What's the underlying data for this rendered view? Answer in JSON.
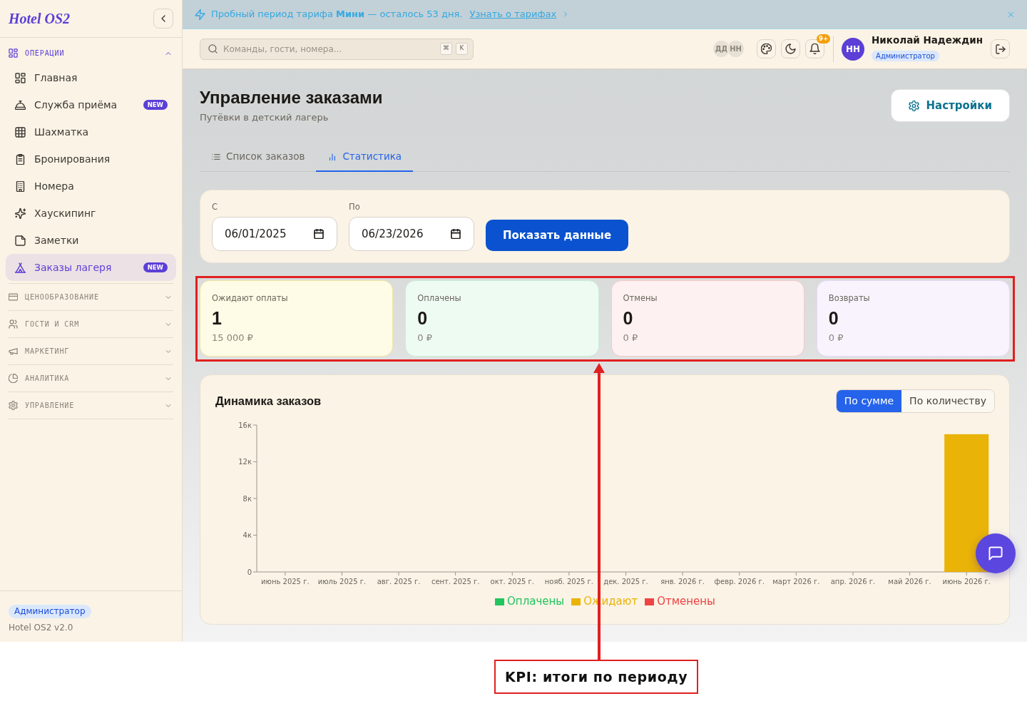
{
  "sidebar": {
    "logo": "Hotel OS2",
    "groups": [
      {
        "label": "ОПЕРАЦИИ",
        "expanded": true,
        "items": [
          {
            "label": "Главная",
            "selected": false
          },
          {
            "label": "Служба приёма",
            "badge": "NEW",
            "selected": false
          },
          {
            "label": "Шахматка",
            "selected": false
          },
          {
            "label": "Бронирования",
            "selected": false
          },
          {
            "label": "Номера",
            "selected": false
          },
          {
            "label": "Хаускипинг",
            "selected": false
          },
          {
            "label": "Заметки",
            "selected": false
          },
          {
            "label": "Заказы лагеря",
            "badge": "NEW",
            "selected": true
          }
        ]
      },
      {
        "label": "ЦЕНООБРАЗОВАНИЕ",
        "expanded": false
      },
      {
        "label": "ГОСТИ И CRM",
        "expanded": false
      },
      {
        "label": "МАРКЕТИНГ",
        "expanded": false
      },
      {
        "label": "АНАЛИТИКА",
        "expanded": false
      },
      {
        "label": "УПРАВЛЕНИЕ",
        "expanded": false
      }
    ],
    "footer": {
      "role": "Администратор",
      "version": "Hotel OS2 v2.0"
    }
  },
  "banner": {
    "text": "Пробный период тарифа **Мини** — осталось 53 дня.",
    "link": "Узнать о тарифах"
  },
  "topbar": {
    "search": {
      "placeholder": "Команды, гости, номера...",
      "shortcut": [
        "⌘",
        "K"
      ]
    },
    "online_users": [
      "ДД",
      "НН"
    ],
    "notifications_badge": "9+",
    "user": {
      "initials": "НН",
      "name": "Николай Надеждин",
      "role": "Администратор"
    }
  },
  "page": {
    "title": "Управление заказами",
    "subtitle": "Путёвки в детский лагерь",
    "settings_button": "Настройки",
    "tabs": [
      {
        "label": "Список заказов",
        "selected": false
      },
      {
        "label": "Статистика",
        "selected": true
      }
    ]
  },
  "filter": {
    "fields": [
      {
        "label": "С",
        "value": "06/01/2025"
      },
      {
        "label": "По",
        "value": "06/23/2026"
      }
    ],
    "submit": "Показать данные"
  },
  "kpis": [
    {
      "kind": "pending",
      "label": "Ожидают оплаты",
      "count": "1",
      "amount": "15 000 ₽"
    },
    {
      "kind": "paid",
      "label": "Оплачены",
      "count": "0",
      "amount": "0 ₽"
    },
    {
      "kind": "cancelled",
      "label": "Отмены",
      "count": "0",
      "amount": "0 ₽"
    },
    {
      "kind": "refund",
      "label": "Возвраты",
      "count": "0",
      "amount": "0 ₽"
    }
  ],
  "chart": {
    "title": "Динамика заказов",
    "modes": [
      {
        "label": "По сумме",
        "selected": true
      },
      {
        "label": "По количеству",
        "selected": false
      }
    ],
    "chart_data": {
      "type": "bar",
      "categories": [
        "июнь 2025 г.",
        "июль 2025 г.",
        "авг. 2025 г.",
        "сент. 2025 г.",
        "окт. 2025 г.",
        "нояб. 2025 г.",
        "дек. 2025 г.",
        "янв. 2026 г.",
        "февр. 2026 г.",
        "март 2026 г.",
        "апр. 2026 г.",
        "май 2026 г.",
        "июнь 2026 г."
      ],
      "series": [
        {
          "name": "Оплачены",
          "color": "#22c55e",
          "values": [
            0,
            0,
            0,
            0,
            0,
            0,
            0,
            0,
            0,
            0,
            0,
            0,
            0
          ]
        },
        {
          "name": "Ожидают",
          "color": "#eab308",
          "values": [
            0,
            0,
            0,
            0,
            0,
            0,
            0,
            0,
            0,
            0,
            0,
            0,
            15
          ]
        },
        {
          "name": "Отменены",
          "color": "#ef4444",
          "values": [
            0,
            0,
            0,
            0,
            0,
            0,
            0,
            0,
            0,
            0,
            0,
            0,
            0
          ]
        }
      ],
      "ylim": [
        0,
        16
      ],
      "yticks": [
        {
          "value": 0,
          "label": "0"
        },
        {
          "value": 4,
          "label": "4к"
        },
        {
          "value": 8,
          "label": "8к"
        },
        {
          "value": 12,
          "label": "12к"
        },
        {
          "value": 16,
          "label": "16к"
        }
      ],
      "stacked": true
    }
  },
  "annotation": {
    "caption": "KPI: итоги по периоду"
  }
}
